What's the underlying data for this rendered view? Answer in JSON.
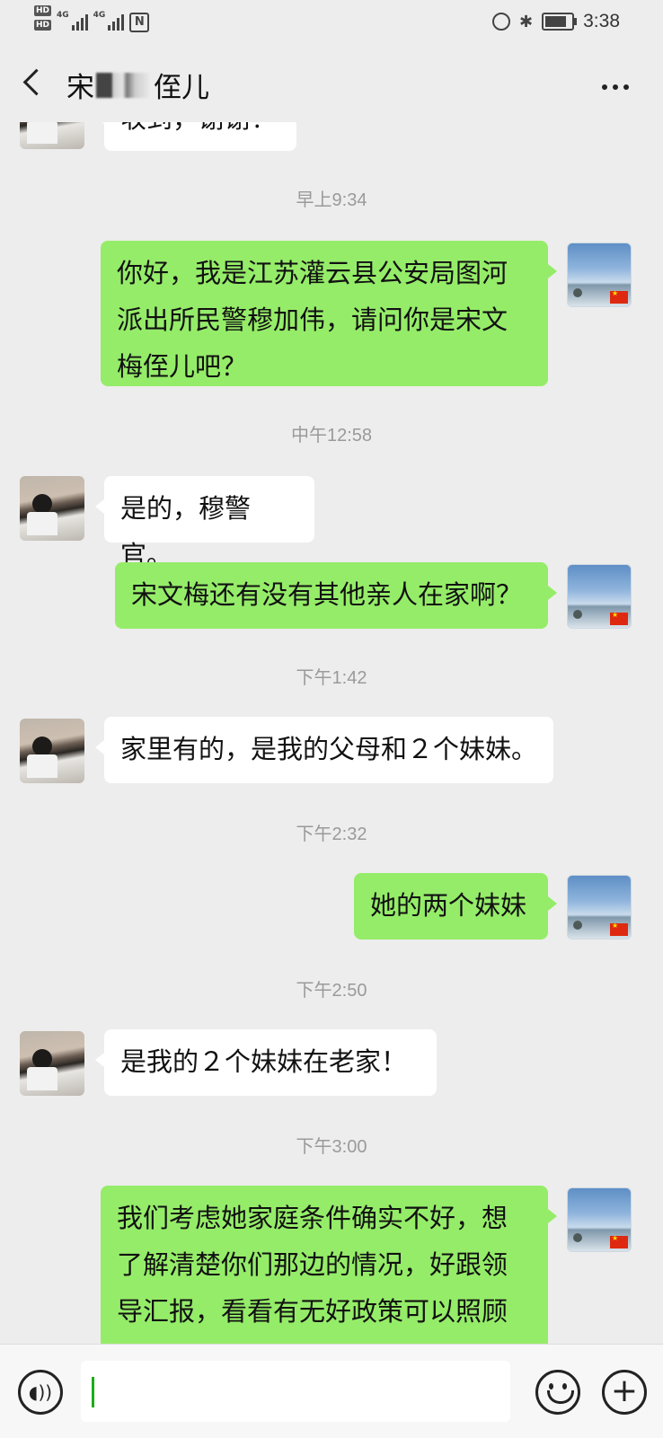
{
  "status_bar": {
    "hd1": "HD",
    "hd2": "HD",
    "net1": "4G",
    "net2": "4G",
    "nfc": "N",
    "time": "3:38"
  },
  "nav": {
    "title_prefix": "宋",
    "title_suffix": "侄儿"
  },
  "timestamps": [
    "早上9:34",
    "中午12:58",
    "下午1:42",
    "下午2:32",
    "下午2:50",
    "下午3:00"
  ],
  "messages": [
    {
      "text": "收到，谢谢！"
    },
    {
      "text": "你好，我是江苏灌云县公安局图河派出所民警穆加伟，请问你是宋文梅侄儿吧？"
    },
    {
      "text": "是的，穆警官。"
    },
    {
      "text": "宋文梅还有没有其他亲人在家啊？"
    },
    {
      "text": "家里有的，是我的父母和２个妹妹。"
    },
    {
      "text": "她的两个妹妹"
    },
    {
      "text": "是我的２个妹妹在老家！"
    },
    {
      "text": "我们考虑她家庭条件确实不好，想了解清楚你们那边的情况，好跟领导汇报，看看有无好政策可以照顾"
    }
  ],
  "input": {
    "value": ""
  },
  "colors": {
    "outgoing": "#95ec69",
    "incoming": "#ffffff",
    "background": "#ededed"
  },
  "icons": [
    "back-icon",
    "more-icon",
    "voice-icon",
    "emoji-icon",
    "plus-icon"
  ]
}
